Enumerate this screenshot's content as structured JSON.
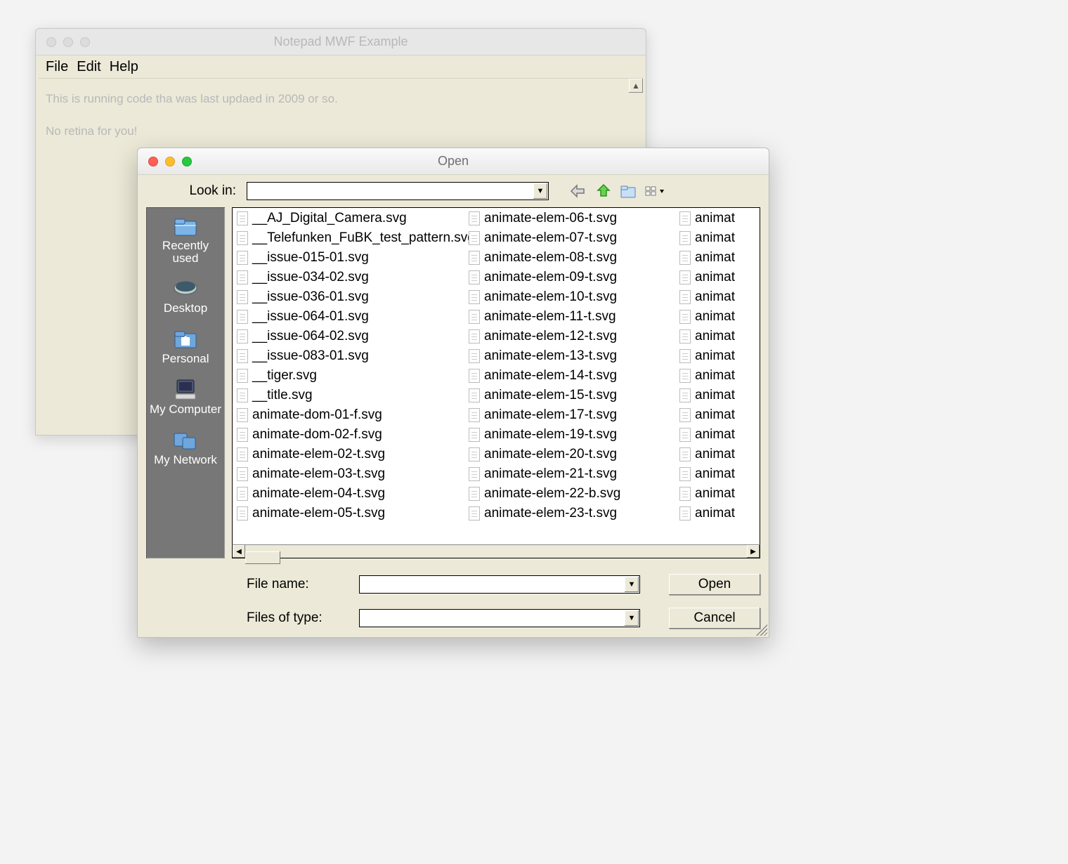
{
  "notepad": {
    "title": "Notepad MWF Example",
    "menus": [
      "File",
      "Edit",
      "Help"
    ],
    "content_line1": "This is running code tha  was last updaed in 2009 or so.",
    "content_line2": "No retina for you!"
  },
  "dialog": {
    "title": "Open",
    "lookin_label": "Look in:",
    "places": [
      {
        "label": "Recently\nused",
        "icon": "recently-used-icon"
      },
      {
        "label": "Desktop",
        "icon": "desktop-icon"
      },
      {
        "label": "Personal",
        "icon": "personal-icon"
      },
      {
        "label": "My Computer",
        "icon": "my-computer-icon"
      },
      {
        "label": "My Network",
        "icon": "my-network-icon"
      }
    ],
    "files_col0": [
      "__AJ_Digital_Camera.svg",
      "__Telefunken_FuBK_test_pattern.svg",
      "__issue-015-01.svg",
      "__issue-034-02.svg",
      "__issue-036-01.svg",
      "__issue-064-01.svg",
      "__issue-064-02.svg",
      "__issue-083-01.svg",
      "__tiger.svg",
      "__title.svg",
      "animate-dom-01-f.svg",
      "animate-dom-02-f.svg",
      "animate-elem-02-t.svg",
      "animate-elem-03-t.svg",
      "animate-elem-04-t.svg",
      "animate-elem-05-t.svg"
    ],
    "files_col1": [
      "animate-elem-06-t.svg",
      "animate-elem-07-t.svg",
      "animate-elem-08-t.svg",
      "animate-elem-09-t.svg",
      "animate-elem-10-t.svg",
      "animate-elem-11-t.svg",
      "animate-elem-12-t.svg",
      "animate-elem-13-t.svg",
      "animate-elem-14-t.svg",
      "animate-elem-15-t.svg",
      "animate-elem-17-t.svg",
      "animate-elem-19-t.svg",
      "animate-elem-20-t.svg",
      "animate-elem-21-t.svg",
      "animate-elem-22-b.svg",
      "animate-elem-23-t.svg"
    ],
    "files_col2": [
      "animat",
      "animat",
      "animat",
      "animat",
      "animat",
      "animat",
      "animat",
      "animat",
      "animat",
      "animat",
      "animat",
      "animat",
      "animat",
      "animat",
      "animat",
      "animat"
    ],
    "filename_label": "File name:",
    "filetype_label": "Files of type:",
    "open_btn": "Open",
    "cancel_btn": "Cancel"
  }
}
